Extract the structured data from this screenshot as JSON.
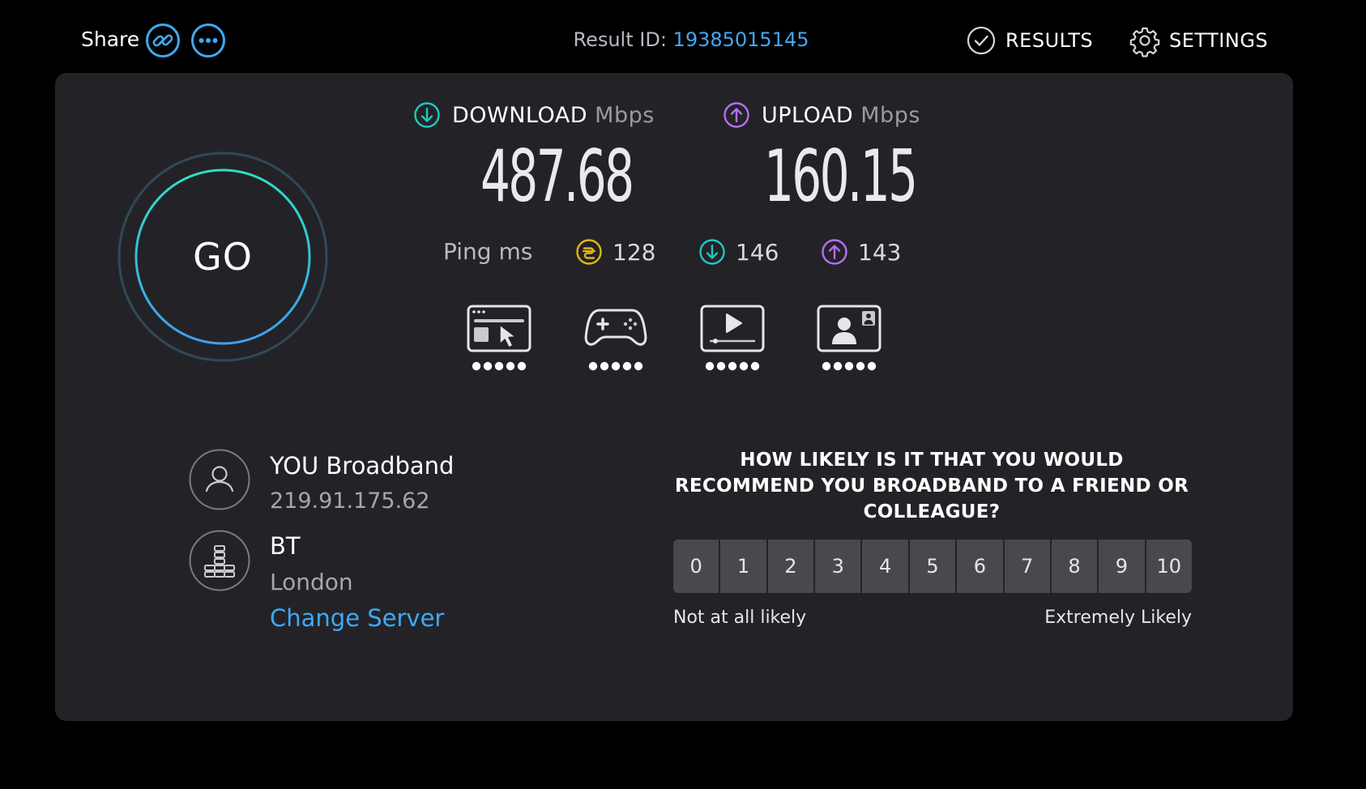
{
  "header": {
    "share_label": "Share",
    "result_id_label": "Result ID:",
    "result_id_value": "19385015145",
    "results_label": "RESULTS",
    "settings_label": "SETTINGS"
  },
  "icons": {
    "share_link": "link-icon",
    "share_more": "more-icon",
    "results": "check-circle-icon",
    "settings": "gear-icon",
    "download": "download-arrow-icon",
    "upload": "upload-arrow-icon",
    "ping_idle": "idle-latency-icon",
    "isp": "user-icon",
    "server": "server-icon"
  },
  "go_label": "GO",
  "download": {
    "label": "DOWNLOAD",
    "unit": "Mbps",
    "value": "487.68"
  },
  "upload": {
    "label": "UPLOAD",
    "unit": "Mbps",
    "value": "160.15"
  },
  "ping": {
    "label": "Ping",
    "unit": "ms",
    "idle": "128",
    "download": "146",
    "upload": "143"
  },
  "quality_icons": [
    {
      "name": "web-browsing-icon",
      "rating": 5,
      "max": 5
    },
    {
      "name": "gaming-icon",
      "rating": 5,
      "max": 5
    },
    {
      "name": "video-streaming-icon",
      "rating": 5,
      "max": 5
    },
    {
      "name": "video-chat-icon",
      "rating": 5,
      "max": 5
    }
  ],
  "isp": {
    "name": "YOU Broadband",
    "ip": "219.91.175.62"
  },
  "server": {
    "name": "BT",
    "location": "London",
    "change_label": "Change Server"
  },
  "survey": {
    "question": "HOW LIKELY IS IT THAT YOU WOULD RECOMMEND YOU BROADBAND TO A FRIEND OR COLLEAGUE?",
    "options": [
      "0",
      "1",
      "2",
      "3",
      "4",
      "5",
      "6",
      "7",
      "8",
      "9",
      "10"
    ],
    "low_label": "Not at all likely",
    "high_label": "Extremely Likely"
  },
  "colors": {
    "background": "#000000",
    "panel": "#232327",
    "accent_blue": "#3fa9f5",
    "download_teal": "#1fc7c2",
    "upload_purple": "#b66ef2",
    "ping_yellow": "#e2b714",
    "rating_button": "#48484e"
  }
}
